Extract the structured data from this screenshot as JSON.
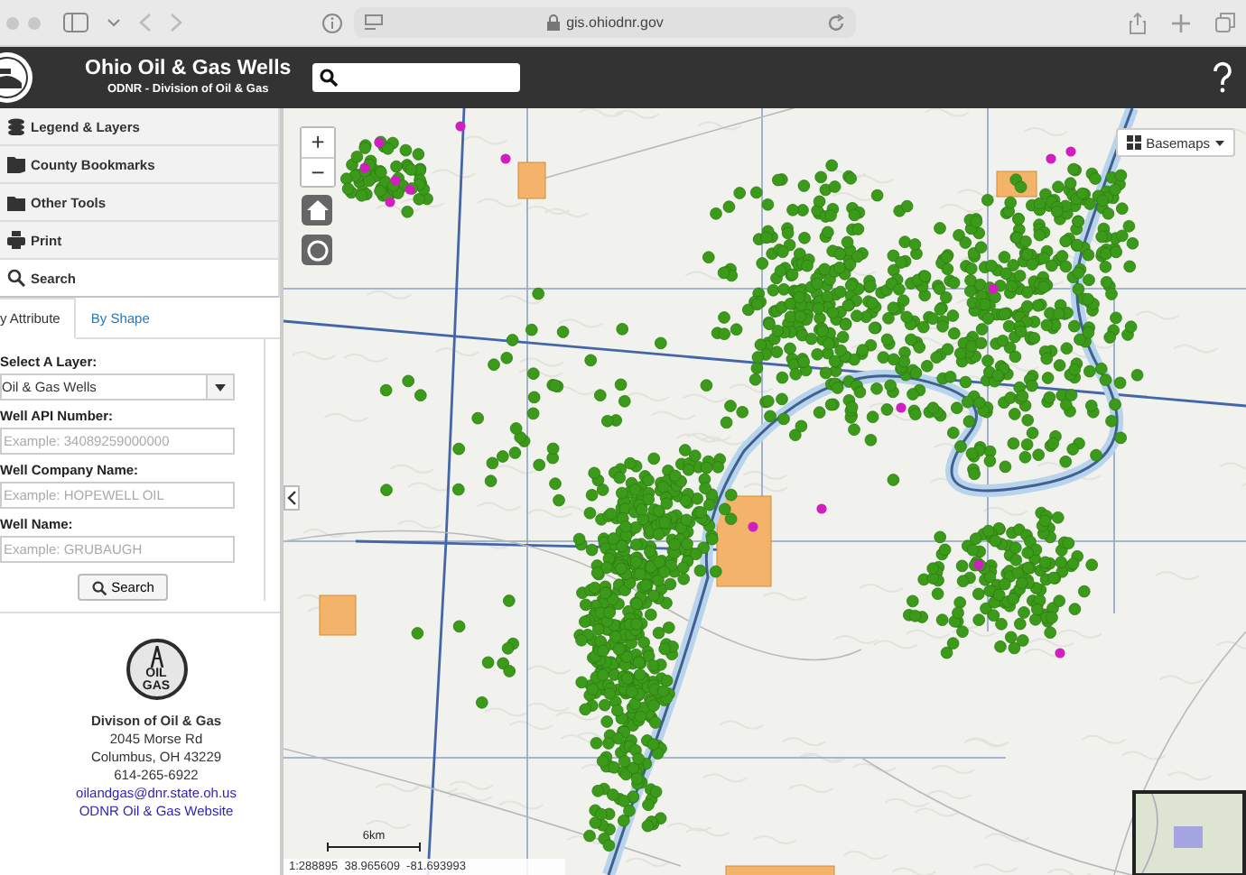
{
  "browser": {
    "url": "gis.ohiodnr.gov"
  },
  "header": {
    "title": "Ohio Oil & Gas Wells",
    "subtitle": "ODNR - Division of Oil & Gas"
  },
  "sidebar": {
    "panels": [
      {
        "kind": "layers",
        "label": "Legend & Layers",
        "expanded": false
      },
      {
        "kind": "bookmarks",
        "label": "County Bookmarks",
        "expanded": false
      },
      {
        "kind": "tools",
        "label": "Other Tools",
        "expanded": false
      },
      {
        "kind": "print",
        "label": "Print",
        "expanded": false
      },
      {
        "kind": "search",
        "label": "Search",
        "expanded": true
      }
    ],
    "search": {
      "tabs": [
        {
          "label": "y Attribute",
          "selected": true
        },
        {
          "label": "By Shape",
          "selected": false
        }
      ],
      "layer_select": {
        "label": "Select A Layer:",
        "value": "Oil & Gas Wells"
      },
      "fields": [
        {
          "label": "Well API Number:",
          "placeholder": "Example: 34089259000000"
        },
        {
          "label": "Well Company Name:",
          "placeholder": "Example: HOPEWELL OIL"
        },
        {
          "label": "Well Name:",
          "placeholder": "Example: GRUBAUGH"
        }
      ],
      "button": "Search"
    },
    "contact": {
      "logo_lines": [
        "OIL",
        "GAS"
      ],
      "name": "Divison of Oil & Gas",
      "lines": [
        "2045 Morse Rd",
        "Columbus, OH 43229",
        "614-265-6922"
      ],
      "links": [
        "oilandgas@dnr.state.oh.us",
        "ODNR Oil & Gas Website"
      ]
    }
  },
  "map": {
    "zoom_in": "+",
    "zoom_out": "−",
    "basemaps": "Basemaps",
    "scale_label": "6km",
    "coordinates": "1:288895  38.965609  -81.693993"
  }
}
